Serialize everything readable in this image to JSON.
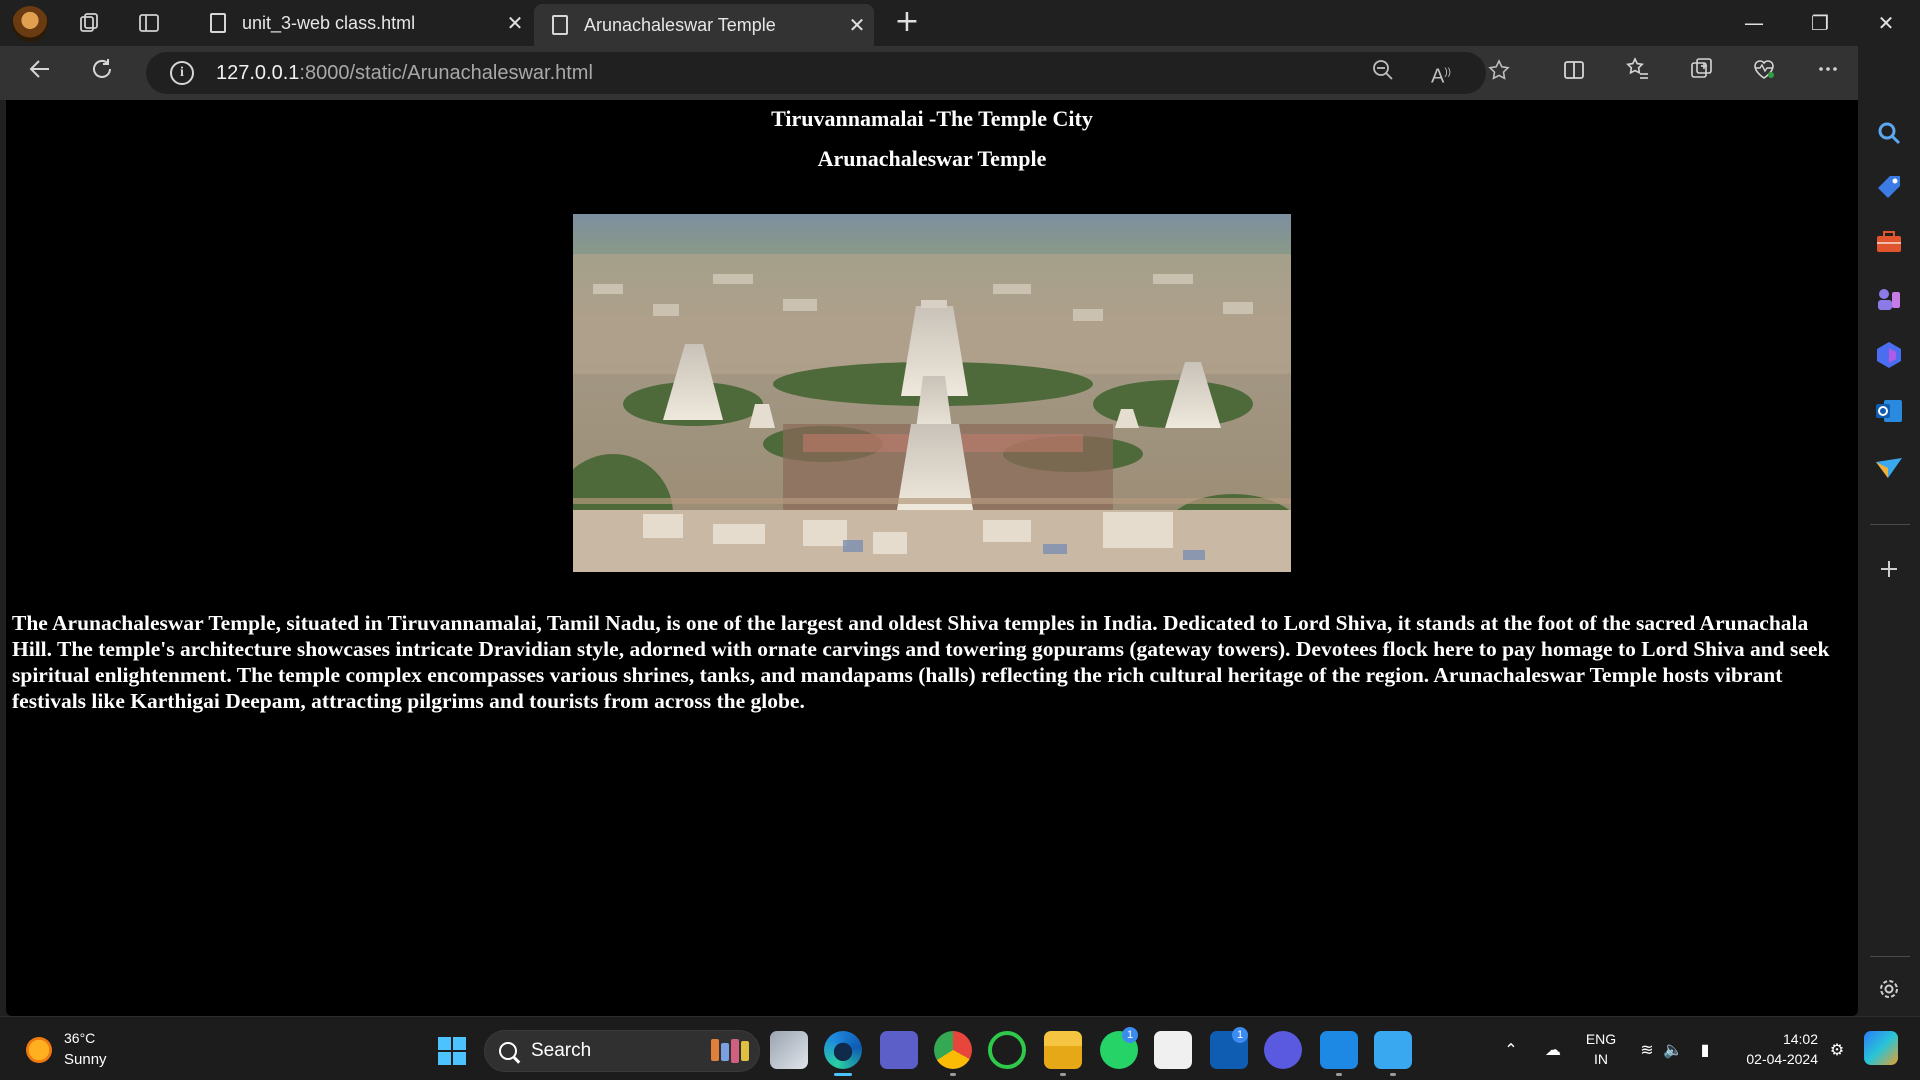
{
  "browser": {
    "tabs": [
      {
        "label": "unit_3-web class.html",
        "close": "✕"
      },
      {
        "label": "Arunachaleswar Temple",
        "close": "✕"
      }
    ],
    "new_tab": "+",
    "window": {
      "minimize": "—",
      "restore": "❐",
      "close": "✕"
    },
    "address": {
      "host": "127.0.0.1",
      "path": ":8000/static/Arunachaleswar.html"
    },
    "toolbar_icons": [
      "back-icon",
      "refresh-icon",
      "zoom-out-icon",
      "read-aloud-icon",
      "favorite-star-icon",
      "split-screen-icon",
      "favorites-icon",
      "collections-icon",
      "health-icon",
      "more-icon",
      "copilot-icon"
    ]
  },
  "page": {
    "heading_city": "Tiruvannamalai -The Temple City",
    "heading_temple": "Arunachaleswar Temple",
    "paragraph": "The Arunachaleswar Temple, situated in Tiruvannamalai, Tamil Nadu, is one of the largest and oldest Shiva temples in India. Dedicated to Lord Shiva, it stands at the foot of the sacred Arunachala Hill. The temple's architecture showcases intricate Dravidian style, adorned with ornate carvings and towering gopurams (gateway towers). Devotees flock here to pay homage to Lord Shiva and seek spiritual enlightenment. The temple complex encompasses various shrines, tanks, and mandapams (halls) reflecting the rich cultural heritage of the region. Arunachaleswar Temple hosts vibrant festivals like Karthigai Deepam, attracting pilgrims and tourists from across the globe."
  },
  "sidebar": {
    "icons": [
      "search-icon",
      "shopping-tag-icon",
      "tools-briefcase-icon",
      "games-icon",
      "copilot-designer-icon",
      "outlook-icon",
      "send-icon",
      "add-icon",
      "settings-gear-icon"
    ]
  },
  "taskbar": {
    "weather": {
      "temp": "36°C",
      "desc": "Sunny"
    },
    "search_label": "Search",
    "badges": {
      "whatsapp": "1",
      "linkedin": "1"
    },
    "tray": {
      "lang_top": "ENG",
      "lang_bottom": "IN",
      "time": "14:02",
      "date": "02-04-2024"
    }
  },
  "colors": {
    "page_background": "#000000",
    "page_text": "#ffffff",
    "accent": "#4cc2ff"
  }
}
